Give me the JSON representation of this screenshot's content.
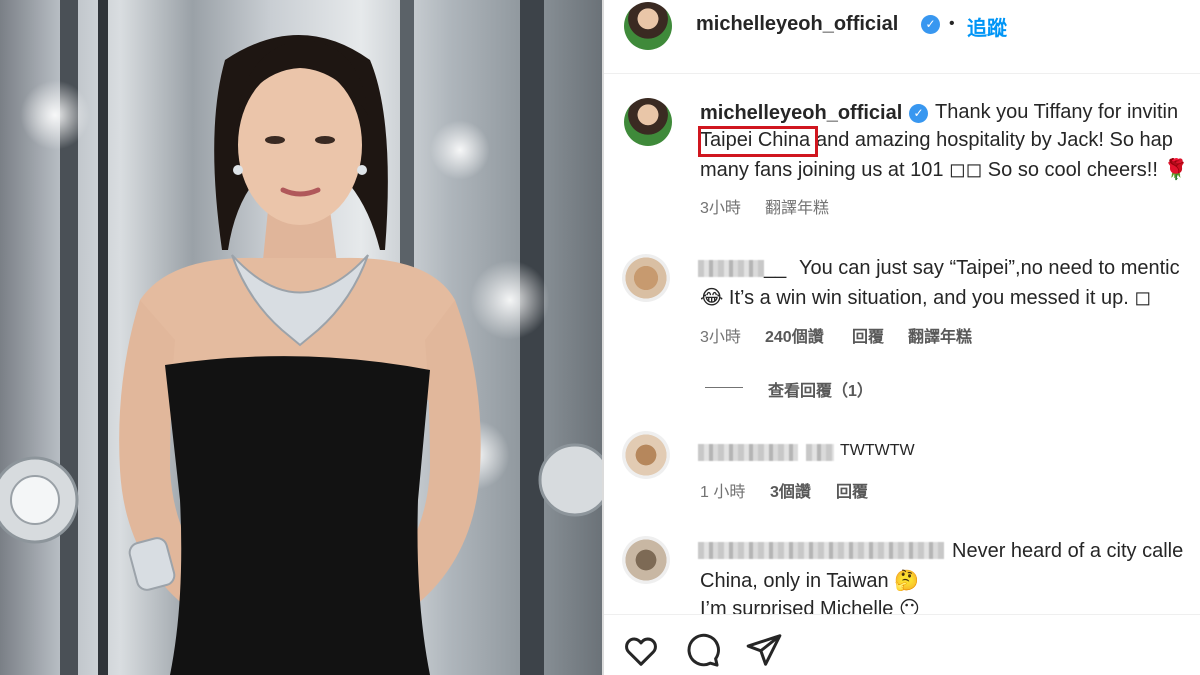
{
  "post": {
    "handle": "michelleyeoh_official",
    "follow_label": "追蹤",
    "caption": {
      "line1": "Thank you Tiffany for invitin",
      "line2_highlight": "Taipei China",
      "line2_rest": " and amazing hospitality by Jack! So hap",
      "line3": "many fans joining us at 101 ◻◻ So so cool cheers!! 🌹"
    },
    "time": "3小時",
    "translate": "翻譯年糕"
  },
  "comments": [
    {
      "name_suffix": "__",
      "text_line1": "You can just say “Taipei”,no need to mentic",
      "text_line2": "😂 It’s a win win situation, and you messed it up. ◻",
      "time": "3小時",
      "likes": "240個讚",
      "reply": "回覆",
      "translate": "翻譯年糕",
      "view_replies": "查看回覆（1）"
    },
    {
      "text_line1": "TWTWTW",
      "time": "1 小時",
      "likes": "3個讚",
      "reply": "回覆"
    },
    {
      "text_line1": "Never heard of a city calle",
      "text_line2": "China, only in Taiwan 🤔",
      "text_line3": "I’m surprised Michelle       😶"
    }
  ],
  "colors": {
    "link_blue": "#0095f6",
    "highlight_red": "#d0161f",
    "verified_blue": "#3897f0"
  },
  "icons": [
    "heart-icon",
    "comment-icon",
    "share-icon",
    "verified-icon"
  ]
}
